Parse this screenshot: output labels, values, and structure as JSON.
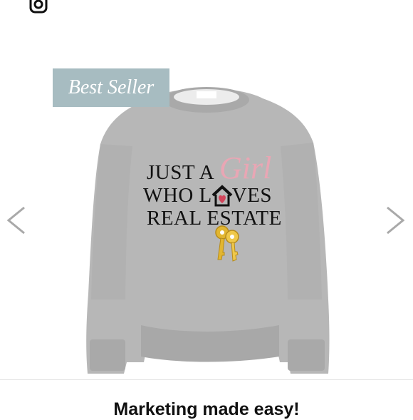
{
  "badge": {
    "label": "Best Seller"
  },
  "print": {
    "line1": "JUST A",
    "girl": "Girl",
    "line2_start": "WHO L",
    "line2_end": "VES",
    "line3": "REAL ESTATE"
  },
  "icons": {
    "top": "instagram-icon",
    "prev": "chevron-left-icon",
    "next": "chevron-right-icon",
    "house": "house-heart-icon",
    "keys": "keys-icon"
  },
  "colors": {
    "badge": "#a7bcc1",
    "sweatshirt": "#b9b9b9",
    "girl_text": "#e9a6b4",
    "heart": "#d2455b",
    "keys": "#e2b631"
  },
  "footer": {
    "text": "Marketing made easy!"
  }
}
